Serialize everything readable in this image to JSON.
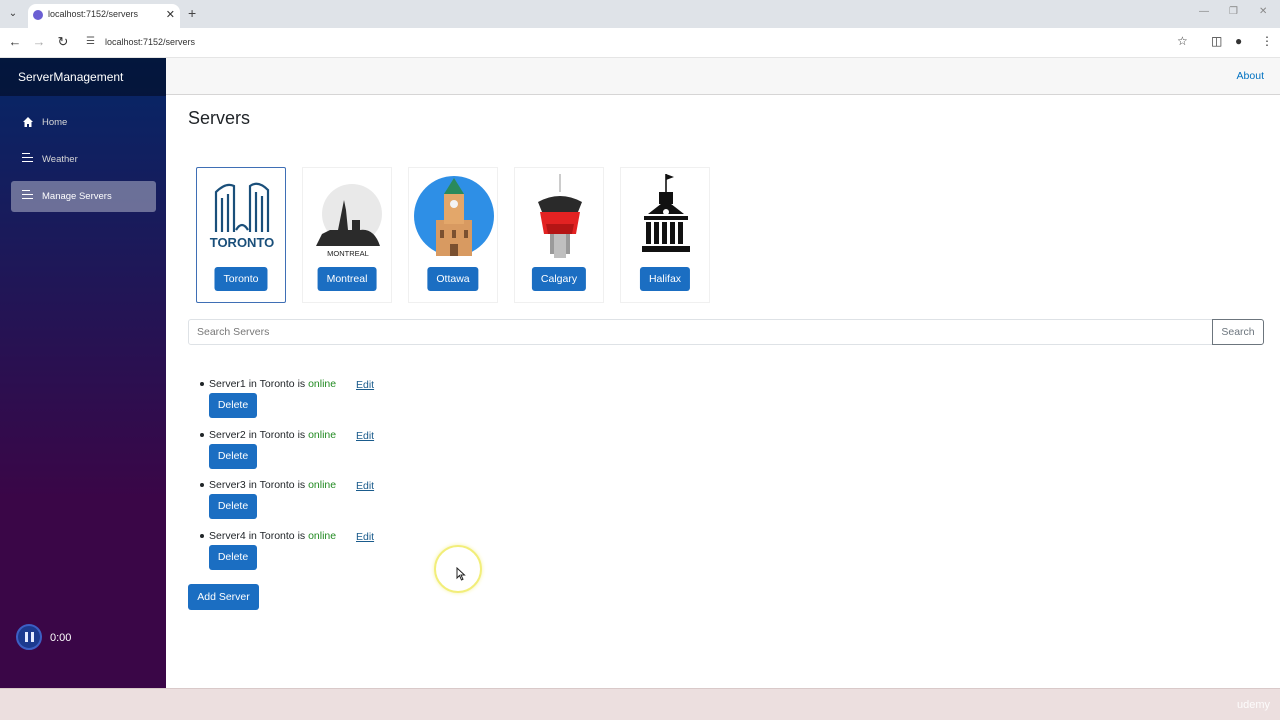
{
  "browser": {
    "tab_title": "localhost:7152/servers",
    "url": "localhost:7152/servers"
  },
  "sidebar": {
    "brand": "ServerManagement",
    "items": [
      {
        "label": "Home",
        "icon": "home-icon",
        "active": false
      },
      {
        "label": "Weather",
        "icon": "list-icon",
        "active": false
      },
      {
        "label": "Manage Servers",
        "icon": "list-icon",
        "active": true
      }
    ],
    "player_time": "0:00"
  },
  "topbar": {
    "about": "About"
  },
  "page": {
    "title": "Servers"
  },
  "cities": [
    {
      "name": "Toronto",
      "selected": true
    },
    {
      "name": "Montreal",
      "selected": false
    },
    {
      "name": "Ottawa",
      "selected": false
    },
    {
      "name": "Calgary",
      "selected": false
    },
    {
      "name": "Halifax",
      "selected": false
    }
  ],
  "city_logos": {
    "toronto_text": "TORONTO",
    "montreal_text": "MONTREAL"
  },
  "search": {
    "placeholder": "Search Servers",
    "button": "Search"
  },
  "servers": [
    {
      "name": "Server1",
      "in_label": "in",
      "city": "Toronto",
      "is_label": "is",
      "status": "online",
      "edit": "Edit",
      "delete": "Delete"
    },
    {
      "name": "Server2",
      "in_label": "in",
      "city": "Toronto",
      "is_label": "is",
      "status": "online",
      "edit": "Edit",
      "delete": "Delete"
    },
    {
      "name": "Server3",
      "in_label": "in",
      "city": "Toronto",
      "is_label": "is",
      "status": "online",
      "edit": "Edit",
      "delete": "Delete"
    },
    {
      "name": "Server4",
      "in_label": "in",
      "city": "Toronto",
      "is_label": "is",
      "status": "online",
      "edit": "Edit",
      "delete": "Delete"
    }
  ],
  "add_server": "Add Server",
  "watermark": "udemy",
  "colors": {
    "primary_button": "#1b6ec2",
    "online_status": "#228b22",
    "link": "#0071c1"
  }
}
